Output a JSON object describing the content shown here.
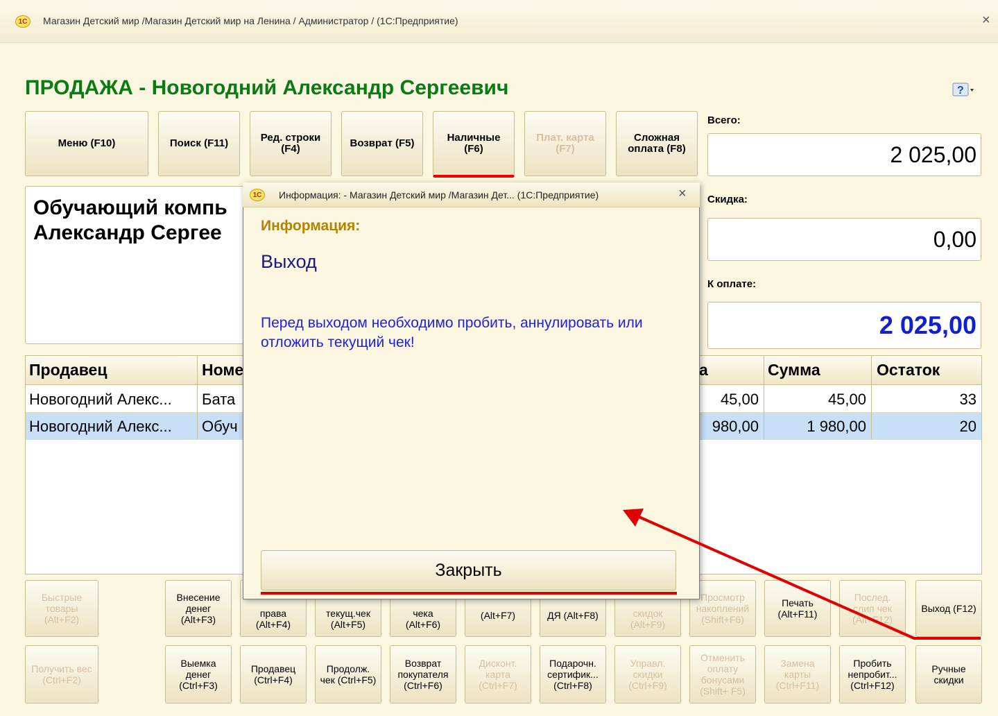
{
  "window": {
    "title": "Магазин Детский мир /Магазин Детский мир на Ленина / Администратор /  (1С:Предприятие)",
    "logo": "1С",
    "close": "×"
  },
  "heading": "ПРОДАЖА - Новогодний Александр Сергеевич",
  "toolbar": [
    {
      "label": "Меню (F10)",
      "enabled": true
    },
    {
      "label": "Поиск (F11)",
      "enabled": true
    },
    {
      "label": "Ред. строки\n(F4)",
      "enabled": true
    },
    {
      "label": "Возврат (F5)",
      "enabled": true
    },
    {
      "label": "Наличные\n(F6)",
      "enabled": true
    },
    {
      "label": "Плат. карта\n(F7)",
      "enabled": false
    },
    {
      "label": "Сложная\nоплата (F8)",
      "enabled": true
    }
  ],
  "totals": {
    "total_label": "Всего:",
    "total_value": "2 025,00",
    "discount_label": "Скидка:",
    "discount_value": "0,00",
    "topay_label": "К оплате:",
    "topay_value": "2 025,00"
  },
  "info_panel": {
    "line1": "Обучающий компь",
    "line2": "Александр Сергее"
  },
  "table": {
    "columns": [
      "Продавец",
      "Номе",
      "а",
      "Сумма",
      "Остаток"
    ],
    "rows": [
      {
        "seller": "Новогодний Алекс...",
        "item": "Бата",
        "price": "45,00",
        "sum": "45,00",
        "rest": "33"
      },
      {
        "seller": "Новогодний Алекс...",
        "item": "Обуч",
        "price": "980,00",
        "sum": "1 980,00",
        "rest": "20"
      }
    ]
  },
  "bottom_row1": [
    {
      "label": "Быстрые\nтовары\n(Alt+F2)",
      "enabled": false
    },
    {
      "label": "Внесение\nденег\n(Alt+F3)",
      "enabled": true
    },
    {
      "label": "права\n(Alt+F4)",
      "enabled": true
    },
    {
      "label": "текущ.чек\n(Alt+F5)",
      "enabled": true
    },
    {
      "label": "чека\n(Alt+F6)",
      "enabled": true
    },
    {
      "label": "(Alt+F7)",
      "enabled": true
    },
    {
      "label": "ДЯ (Alt+F8)",
      "enabled": true
    },
    {
      "label": "скидок\n(Alt+F9)",
      "enabled": false
    },
    {
      "label": "Просмотр\nнакоплений\n(Shift+F6)",
      "enabled": false
    },
    {
      "label": "Печать\n(Alt+F11)",
      "enabled": true
    },
    {
      "label": "Послед.\nслип чек\n(Alt+F12)",
      "enabled": false
    },
    {
      "label": "Выход (F12)",
      "enabled": true
    }
  ],
  "bottom_row2": [
    {
      "label": "Получить вес\n(Ctrl+F2)",
      "enabled": false
    },
    {
      "label": "Выемка\nденег\n(Ctrl+F3)",
      "enabled": true
    },
    {
      "label": "Продавец\n(Ctrl+F4)",
      "enabled": true
    },
    {
      "label": "Продолж.\nчек (Ctrl+F5)",
      "enabled": true
    },
    {
      "label": "Возврат\nпокупателя\n(Ctrl+F6)",
      "enabled": true
    },
    {
      "label": "Дисконт.\nкарта\n(Ctrl+F7)",
      "enabled": false
    },
    {
      "label": "Подарочн.\nсертифик...\n(Ctrl+F8)",
      "enabled": true
    },
    {
      "label": "Управл.\nскидки\n(Ctrl+F9)",
      "enabled": false
    },
    {
      "label": "Отменить\nоплату\nбонусами\n(Shift+ F5)",
      "enabled": false
    },
    {
      "label": "Замена\nкарты\n(Ctrl+F11)",
      "enabled": false
    },
    {
      "label": "Пробить\nнепробит...\n(Ctrl+F12)",
      "enabled": true
    },
    {
      "label": "Ручные\nскидки",
      "enabled": true
    }
  ],
  "dialog": {
    "title": "Информация: - Магазин Детский мир /Магазин Дет...  (1С:Предприятие)",
    "heading": "Информация:",
    "subject": "Выход",
    "message": "Перед выходом необходимо пробить, аннулировать или отложить текущий чек!",
    "close_button": "Закрыть"
  },
  "colors": {
    "heading": "#0a7a14",
    "topay": "#1020d0",
    "dialog_message": "#2020e8",
    "annotation": "#e00000"
  }
}
